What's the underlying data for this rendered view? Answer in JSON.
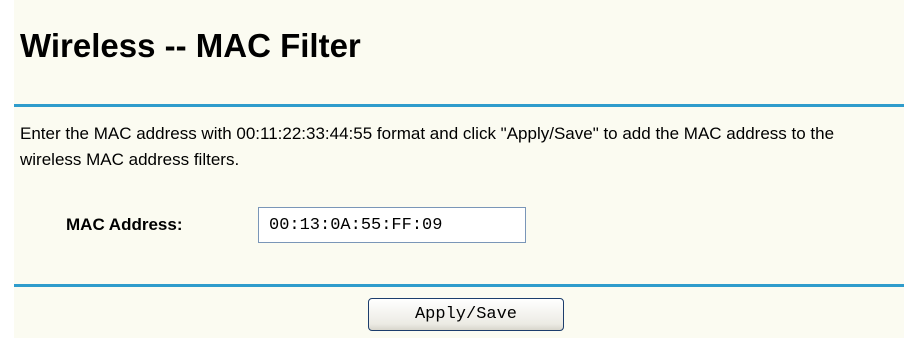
{
  "page": {
    "title": "Wireless -- MAC Filter",
    "description": "Enter the MAC address with 00:11:22:33:44:55 format and click \"Apply/Save\" to add the MAC address to the wireless MAC address filters."
  },
  "form": {
    "mac_label": "MAC Address:",
    "mac_value": "00:13:0A:55:FF:09",
    "apply_label": "Apply/Save"
  },
  "colors": {
    "background": "#fbfbf1",
    "rule": "#2f9ccc"
  }
}
